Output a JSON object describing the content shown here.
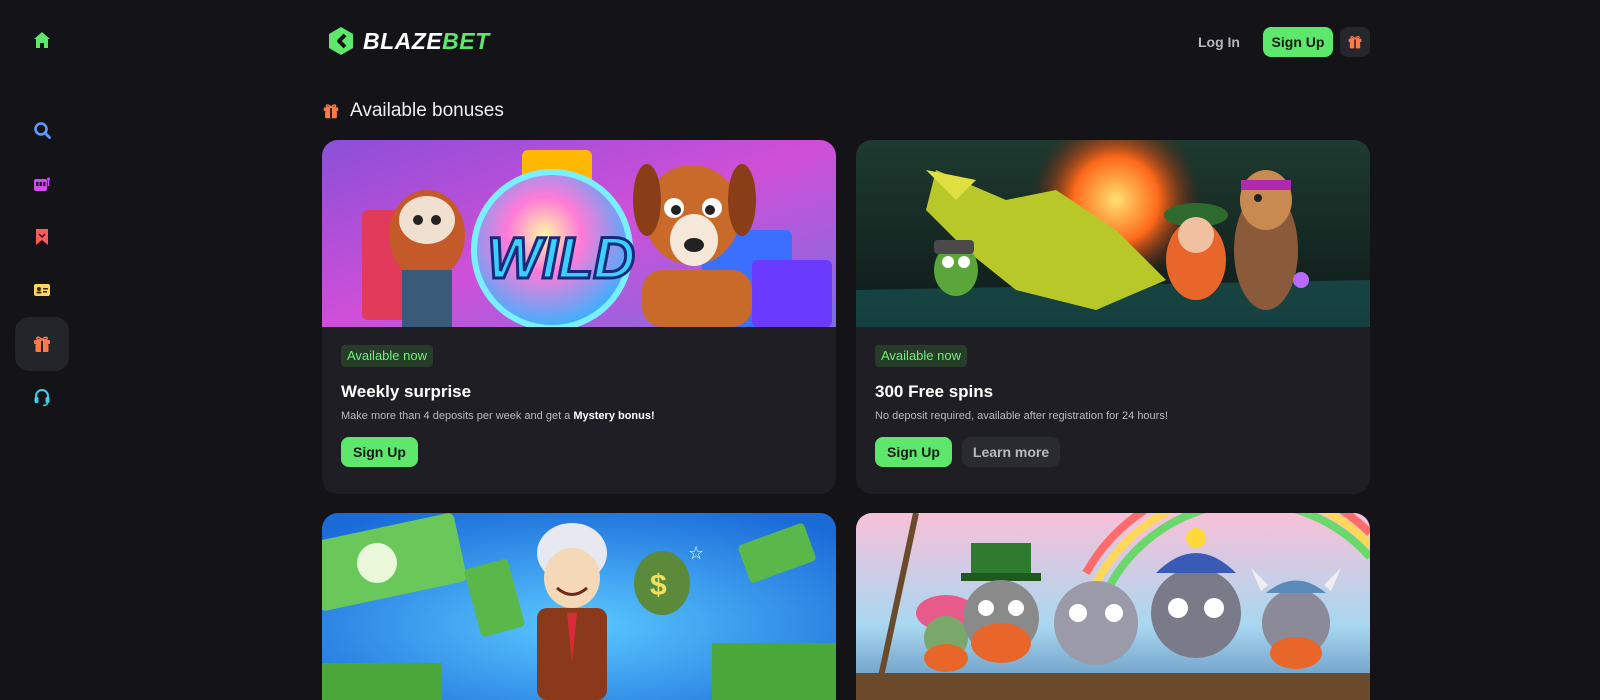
{
  "brand": {
    "logo_text_main": "BLAZE",
    "logo_text_accent": "BET",
    "accent_color": "#5ee86b"
  },
  "header": {
    "login_label": "Log In",
    "signup_label": "Sign Up",
    "gift_icon": "gift-icon"
  },
  "sidebar": {
    "items": [
      {
        "name": "home",
        "icon": "home-icon",
        "color": "#5ee86b"
      },
      {
        "name": "search",
        "icon": "search-icon",
        "color": "#5b9dff"
      },
      {
        "name": "games",
        "icon": "slot-machine-icon",
        "color": "#d24bf2"
      },
      {
        "name": "bookmarks",
        "icon": "bookmark-icon",
        "color": "#ff5a5a"
      },
      {
        "name": "profile",
        "icon": "id-card-icon",
        "color": "#ffd45a"
      },
      {
        "name": "bonuses",
        "icon": "gift-icon",
        "color": "#ff7a45",
        "active": true
      },
      {
        "name": "support",
        "icon": "headset-icon",
        "color": "#3ad0e8"
      }
    ]
  },
  "section": {
    "title": "Available bonuses",
    "icon": "gift-icon"
  },
  "bonuses": [
    {
      "badge": "Available now",
      "title": "Weekly surprise",
      "desc_prefix": "Make more than 4 deposits per week and get a ",
      "desc_bold": "Mystery bonus!",
      "primary_label": "Sign Up"
    },
    {
      "badge": "Available now",
      "title": "300 Free spins",
      "desc_prefix": "No deposit required, available after registration for 24 hours!",
      "primary_label": "Sign Up",
      "secondary_label": "Learn more"
    }
  ]
}
